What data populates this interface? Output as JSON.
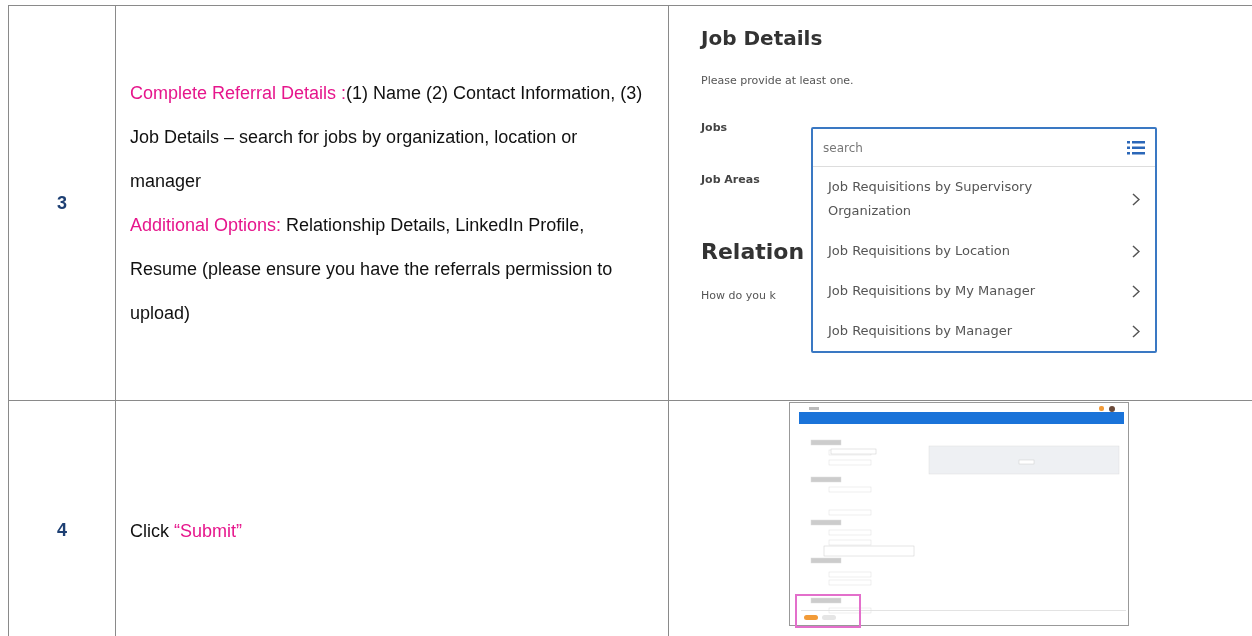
{
  "rows": [
    {
      "step": "3",
      "paragraphs": [
        [
          {
            "text": "Complete Referral Details :",
            "highlight": true
          },
          {
            "text": "(1) Name (2) Contact Information, (3) Job Details – search for jobs by organization, location or manager",
            "highlight": false
          }
        ],
        [
          {
            "text": "Additional Options:",
            "highlight": true
          },
          {
            "text": " Relationship Details, LinkedIn Profile, Resume (please ensure you have the referrals permission to upload)",
            "highlight": false
          }
        ]
      ],
      "screenshot": {
        "kind": "job_details",
        "heading": "Job Details",
        "hint": "Please provide at least one.",
        "fields": [
          "Jobs",
          "Job Areas"
        ],
        "section_heading": "Relation",
        "section_hint": "How do you k",
        "search_placeholder": "search",
        "menu_items": [
          "Job Requisitions by Supervisory Organization",
          "Job Requisitions by Location",
          "Job Requisitions by My Manager",
          "Job Requisitions by Manager"
        ]
      }
    },
    {
      "step": "4",
      "paragraphs": [
        [
          {
            "text": "Click ",
            "highlight": false
          },
          {
            "text": "“Submit”",
            "highlight": true
          }
        ]
      ],
      "screenshot": {
        "kind": "form_overview",
        "highlighted": true
      }
    }
  ]
}
